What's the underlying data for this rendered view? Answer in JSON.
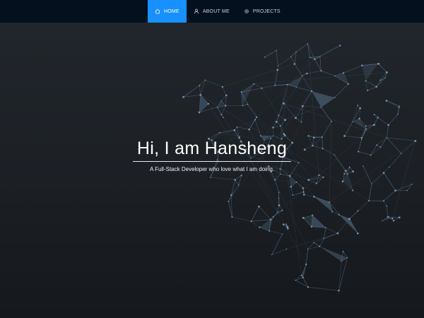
{
  "nav": {
    "items": [
      {
        "label": "HOME",
        "icon": "home-icon",
        "active": true
      },
      {
        "label": "ABOUT ME",
        "icon": "user-icon",
        "active": false
      },
      {
        "label": "PROJECTS",
        "icon": "gear-icon",
        "active": false
      }
    ]
  },
  "hero": {
    "title": "Hi, I am Hansheng",
    "subtitle": "A Full-Stack Developer who love what I am doing."
  },
  "colors": {
    "navbar_bg": "#04101e",
    "nav_active": "#1890ff",
    "network_line": "#5a7690"
  }
}
